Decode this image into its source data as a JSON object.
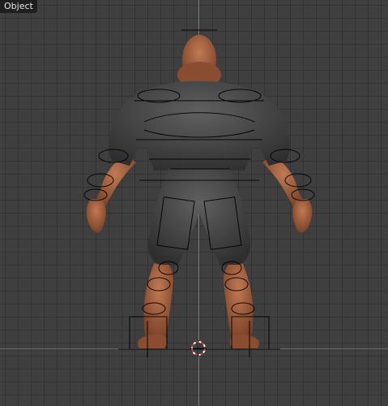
{
  "viewport": {
    "mode_label": "Object",
    "colors": {
      "background": "#3f3f3f",
      "grid": "#333333",
      "axis_x": "#b04e4e",
      "axis_z": "#6f8fd8",
      "skin": "#9a5a39",
      "clothing": "#4c4c4c",
      "bone_shape": "#000000",
      "cursor_red": "#d23b3b"
    },
    "icons": {
      "cursor": "3d-cursor-icon",
      "origin": "origin-marker-icon"
    }
  }
}
